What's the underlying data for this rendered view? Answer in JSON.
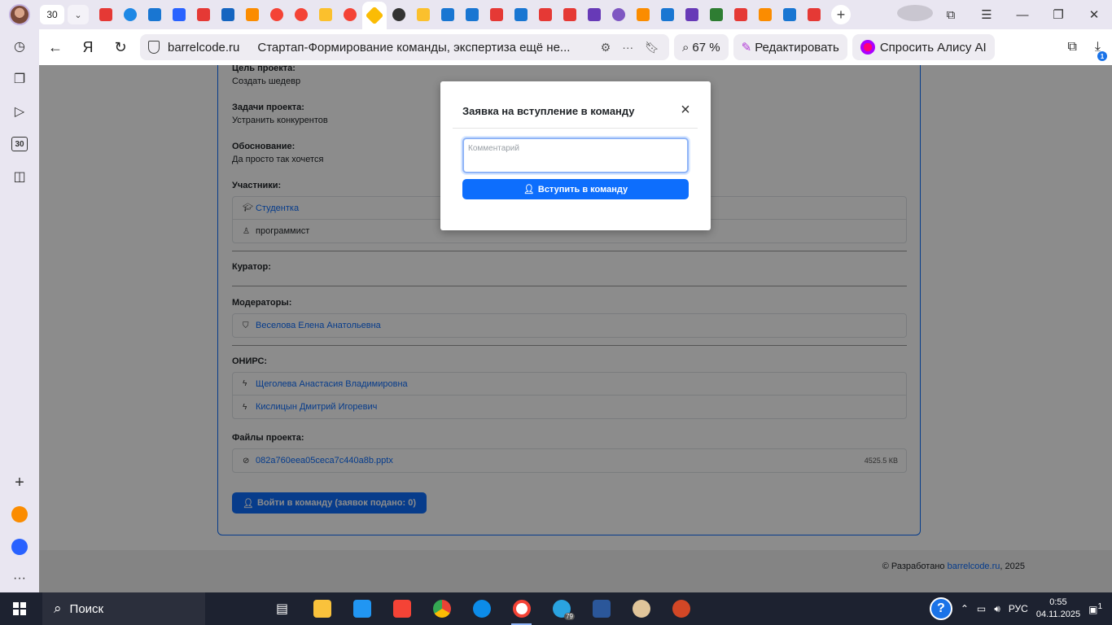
{
  "browser": {
    "tab_count": "30",
    "url_domain": "barrelcode.ru",
    "page_title": "Стартап-Формирование команды, экспертиза ещё не...",
    "zoom": "67 %",
    "edit_label": "Редактировать",
    "alisa_label": "Спросить Алису AI",
    "downloads_badge": "1",
    "sidebar_calendar": "30"
  },
  "project": {
    "goal_label": "Цель проекта:",
    "goal_value": "Создать шедевр",
    "tasks_label": "Задачи проекта:",
    "tasks_value": "Устранить конкурентов",
    "reason_label": "Обоснование:",
    "reason_value": "Да просто так хочется",
    "participants_label": "Участники:",
    "participants": [
      {
        "name": "Студентка"
      },
      {
        "name": "программист"
      }
    ],
    "curator_label": "Куратор:",
    "moderators_label": "Модераторы:",
    "moderators": [
      {
        "name": "Веселова Елена Анатольевна"
      }
    ],
    "onirs_label": "ОНИРС:",
    "onirs": [
      {
        "name": "Щеголева Анастасия Владимировна"
      },
      {
        "name": "Кислицын Дмитрий Игоревич"
      }
    ],
    "files_label": "Файлы проекта:",
    "files": [
      {
        "name": "082a760eea05ceca7c440a8b.pptx",
        "size": "4525.5 КВ"
      }
    ],
    "join_button": "Войти в команду (заявок подано: 0)"
  },
  "footer": {
    "prefix": "© Разработано",
    "link": "barrelcode.ru",
    "suffix": ", 2025"
  },
  "modal": {
    "title": "Заявка на вступление в команду",
    "comment_placeholder": "Комментарий",
    "submit_label": "Вступить в команду"
  },
  "taskbar": {
    "search_label": "Поиск",
    "language": "РУС",
    "time": "0:55",
    "date": "04.11.2025",
    "telegram_badge": "79",
    "notifications": "1"
  }
}
